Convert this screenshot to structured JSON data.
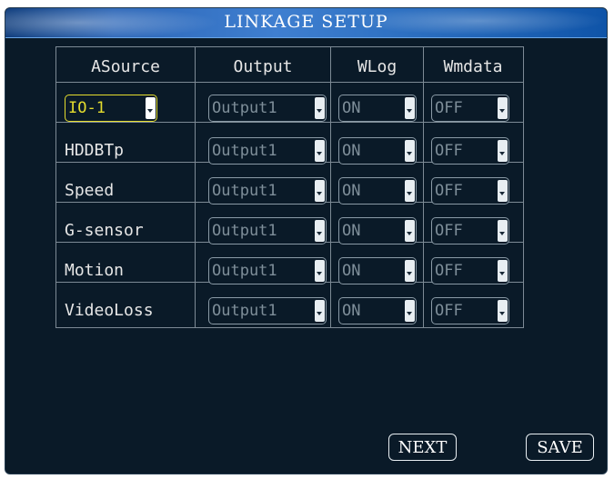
{
  "window": {
    "title": "LINKAGE SETUP"
  },
  "table": {
    "headers": [
      "ASource",
      "Output",
      "WLog",
      "Wmdata"
    ],
    "rows": [
      {
        "source": "IO-1",
        "output": "Output1",
        "wlog": "ON",
        "wmdata": "OFF"
      },
      {
        "source": "HDDBTp",
        "output": "Output1",
        "wlog": "ON",
        "wmdata": "OFF"
      },
      {
        "source": "Speed",
        "output": "Output1",
        "wlog": "ON",
        "wmdata": "OFF"
      },
      {
        "source": "G-sensor",
        "output": "Output1",
        "wlog": "ON",
        "wmdata": "OFF"
      },
      {
        "source": "Motion",
        "output": "Output1",
        "wlog": "ON",
        "wmdata": "OFF"
      },
      {
        "source": "VideoLoss",
        "output": "Output1",
        "wlog": "ON",
        "wmdata": "OFF"
      }
    ]
  },
  "buttons": {
    "next": "NEXT",
    "save": "SAVE"
  },
  "colors": {
    "background": "#0a1a28",
    "titlebar": "#2d67b8",
    "highlight": "#e5dd2e",
    "grid": "#7d8a95"
  }
}
